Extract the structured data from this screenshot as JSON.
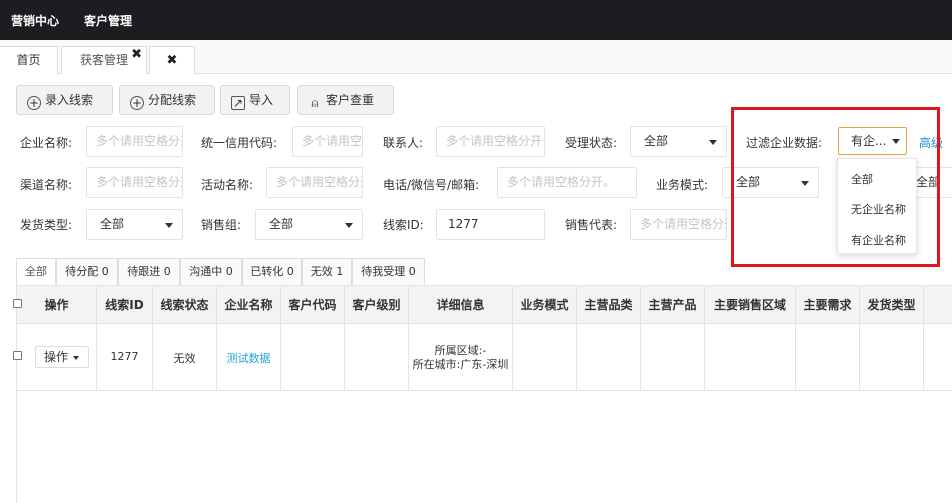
{
  "topbar": {
    "nav": [
      "营销中心",
      "客户管理"
    ]
  },
  "tabs": {
    "home": "首页",
    "active": "获客管理",
    "close_glyph": "✖"
  },
  "toolbar": {
    "buttons": [
      {
        "icon": "plus-circle-icon",
        "glyph": "+",
        "label": "录入线索"
      },
      {
        "icon": "plus-circle-icon",
        "glyph": "+",
        "label": "分配线索"
      },
      {
        "icon": "export-icon",
        "glyph": "↗",
        "label": "导入"
      },
      {
        "icon": "user-icon",
        "glyph": "⍝",
        "label": "客户查重"
      }
    ]
  },
  "filters": {
    "company_name": {
      "label": "企业名称:",
      "placeholder": "多个请用空格分开"
    },
    "credit_code": {
      "label": "统一信用代码:",
      "placeholder": "多个请用空格分开"
    },
    "contact": {
      "label": "联系人:",
      "placeholder": "多个请用空格分开"
    },
    "accept_status": {
      "label": "受理状态:",
      "value": "全部"
    },
    "filter_company": {
      "label": "过滤企业数据:",
      "value": "有企..."
    },
    "advanced": "高级",
    "channel": {
      "label": "渠道名称:",
      "placeholder": "多个请用空格分开"
    },
    "activity": {
      "label": "活动名称:",
      "placeholder": "多个请用空格分开"
    },
    "phone": {
      "label": "电话/微信号/邮箱:",
      "placeholder": "多个请用空格分开。"
    },
    "biz_mode": {
      "label": "业务模式:",
      "value": "全部"
    },
    "hidden_select": {
      "value": "全部"
    },
    "ship_type": {
      "label": "发货类型:",
      "value": "全部"
    },
    "sales_group": {
      "label": "销售组:",
      "value": "全部"
    },
    "lead_id": {
      "label": "线索ID:",
      "value": "1277"
    },
    "sales_rep": {
      "label": "销售代表:",
      "placeholder": "多个请用空格分开"
    }
  },
  "dropdown": {
    "options": [
      "全部",
      "无企业名称",
      "有企业名称"
    ]
  },
  "status_tabs": [
    "全部",
    "待分配 0",
    "待跟进 0",
    "沟通中 0",
    "已转化 0",
    "无效 1",
    "待我受理 0"
  ],
  "table": {
    "columns": [
      "操作",
      "线索ID",
      "线索状态",
      "企业名称",
      "客户代码",
      "客户级别",
      "详细信息",
      "业务模式",
      "主营品类",
      "主营产品",
      "主要销售区域",
      "主要需求",
      "发货类型"
    ],
    "rows": [
      {
        "action": "操作",
        "id": "1277",
        "status": "无效",
        "company": "测试数据",
        "detail_line1": "所属区域:-",
        "detail_line2": "所在城市:广东-深圳"
      }
    ]
  },
  "colors": {
    "topbar": "#1b1d20",
    "link": "#1fa4dc",
    "highlight": "#e0161e",
    "focus": "#e6a23c"
  }
}
